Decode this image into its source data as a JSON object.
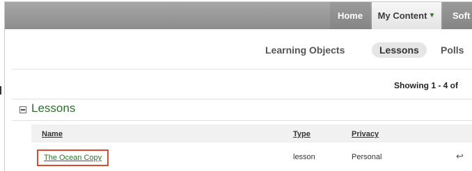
{
  "nav": {
    "home": "Home",
    "my_content": "My Content",
    "my_content_caret": "▼",
    "soft_partial": "Soft"
  },
  "subtabs": {
    "learning_objects": "Learning Objects",
    "lessons": "Lessons",
    "polls": "Polls"
  },
  "results": {
    "showing": "Showing 1 - 4 of"
  },
  "section": {
    "title": "Lessons",
    "toggle_icon": "collapse-minus-icon"
  },
  "table": {
    "headers": {
      "name": "Name",
      "type": "Type",
      "privacy": "Privacy"
    },
    "rows": [
      {
        "name": "The Ocean Copy",
        "type": "lesson",
        "privacy": "Personal",
        "action_icon": "↩"
      }
    ]
  },
  "colors": {
    "topbar": "#9a9a9a",
    "accent_green": "#2d6e2d",
    "highlight_red": "#e0482c"
  }
}
